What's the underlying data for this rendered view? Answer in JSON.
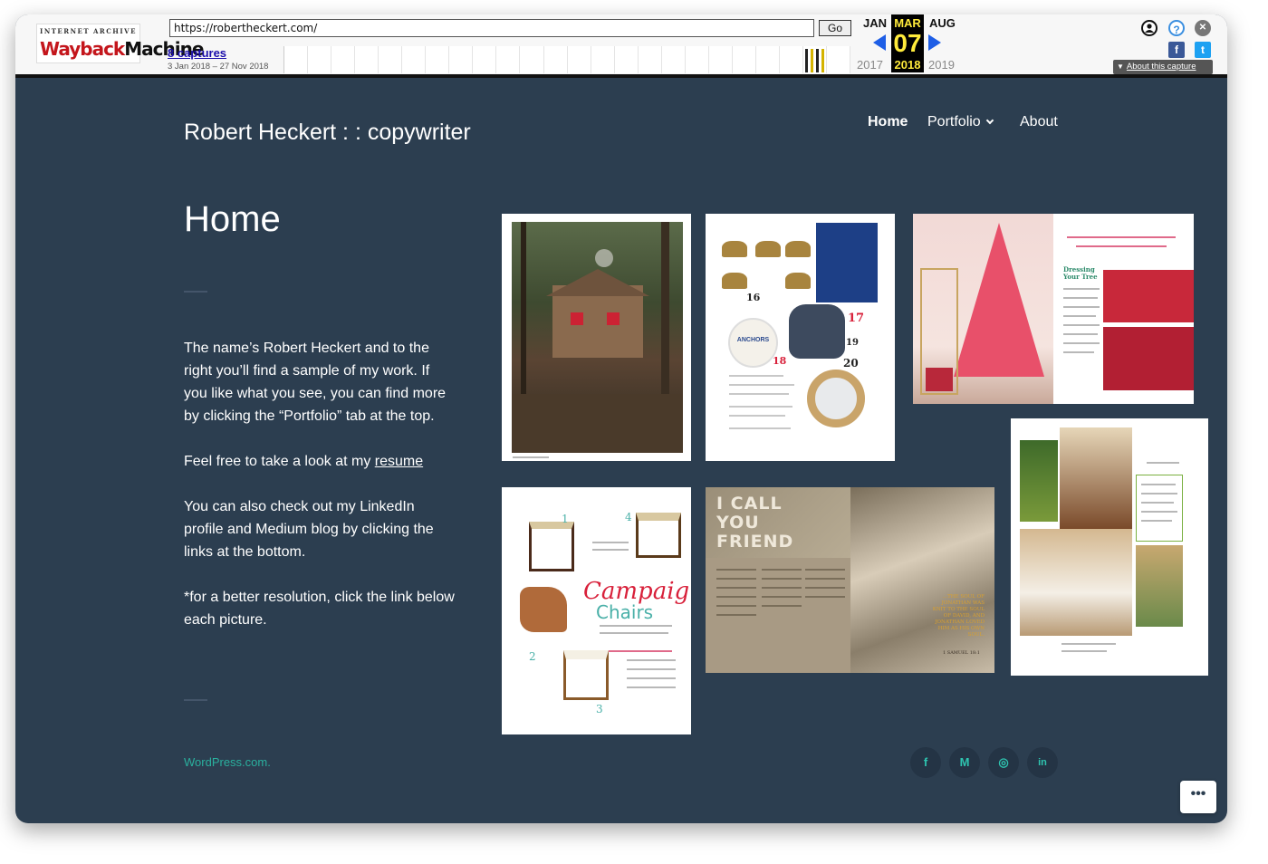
{
  "wayback": {
    "logo_top": "INTERNET ARCHIVE",
    "logo_bottom_a": "Wayback",
    "logo_bottom_b": "Machine",
    "url": "https://robertheckert.com/",
    "go_label": "Go",
    "captures": "8 captures",
    "date_range": "3 Jan 2018 – 27 Nov 2018",
    "prev_month": "JAN",
    "current_month": "MAR",
    "next_month": "AUG",
    "current_day": "07",
    "prev_year": "2017",
    "current_year": "2018",
    "next_year": "2019",
    "about_capture": "About this capture",
    "help_glyph": "?",
    "close_glyph": "✕",
    "facebook_glyph": "f",
    "twitter_glyph": "t",
    "collapse_glyph": "▼"
  },
  "site": {
    "title": "Robert Heckert : : copywriter",
    "nav": {
      "home": "Home",
      "portfolio": "Portfolio",
      "about": "About"
    },
    "page_title": "Home",
    "paragraphs": {
      "p1": "The name’s Robert Heckert and to the right you’ll find a sample of my work. If you like what you see, you can find more by clicking the “Portfolio” tab at the top.",
      "p2_prefix": "Feel free to take a look at my ",
      "p2_link": "resume",
      "p3": "You can also check out my LinkedIn profile and Medium blog by clicking the links at the bottom.",
      "p4": "*for a better resolution, click the link below each picture."
    },
    "footer_credit": "WordPress.com.",
    "social": {
      "facebook": "f",
      "medium": "M",
      "instagram": "◎",
      "linkedin": "in"
    },
    "more_label": "•••"
  },
  "gallery": {
    "tile2_numbers": [
      "16",
      "17",
      "18",
      "19",
      "20"
    ],
    "tile2_badge": "ANCHORS",
    "tile3_heading": "Dressing Your Tree",
    "tile5_title_a": "Campaign",
    "tile5_title_b": "Chairs",
    "tile5_numbers": [
      "1",
      "2",
      "3",
      "4"
    ],
    "tile6_title": "I CALL YOU FRIEND",
    "tile6_quote": "...THE SOUL OF JONATHAN WAS KNIT TO THE SOUL OF DAVID, AND JONATHAN LOVED HIM AS HIS OWN SOUL.",
    "tile6_cite": "1 SAMUEL 18:1"
  }
}
